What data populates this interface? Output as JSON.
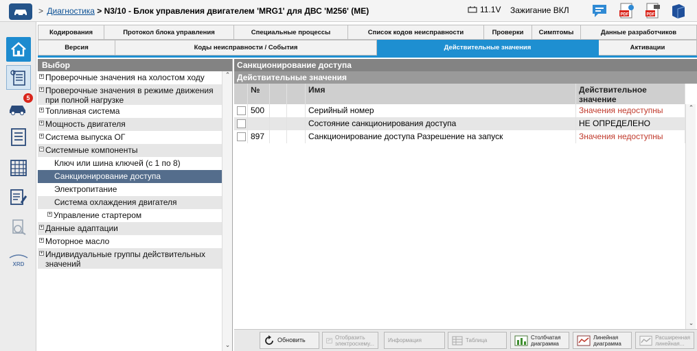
{
  "header": {
    "breadcrumb_sep": ">",
    "breadcrumb_link": "Диагностика",
    "title": "> N3/10 - Блок управления двигателем 'MRG1' для ДВС 'M256' (ME)",
    "voltage": "11.1V",
    "ignition": "Зажигание ВКЛ",
    "icons": [
      "chat-icon",
      "pdf-export-icon",
      "pdf-print-icon",
      "help-book-icon"
    ]
  },
  "rail": {
    "badge_count": "5",
    "xrd_label": "XRD"
  },
  "tabs_row1": [
    "Кодирования",
    "Протокол блока управления",
    "Специальные процессы",
    "Список кодов неисправности",
    "Проверки",
    "Симптомы",
    "Данные разработчиков"
  ],
  "tabs_row2": [
    "Версия",
    "Коды неисправности / События",
    "Действительные значения",
    "Активации"
  ],
  "active_tab": "Действительные значения",
  "left_panel": {
    "title": "Выбор",
    "tree": [
      {
        "label": "Проверочные значения на холостом ходу",
        "expander": "+",
        "level": 0
      },
      {
        "label": "Проверочные значения в режиме движения при полной нагрузке",
        "expander": "+",
        "level": 0
      },
      {
        "label": "Топливная система",
        "expander": "+",
        "level": 0
      },
      {
        "label": "Мощность двигателя",
        "expander": "+",
        "level": 0
      },
      {
        "label": "Система выпуска ОГ",
        "expander": "+",
        "level": 0
      },
      {
        "label": "Системные компоненты",
        "expander": "−",
        "level": 0
      },
      {
        "label": "Ключ или шина ключей (с 1 по 8)",
        "expander": "",
        "level": 1
      },
      {
        "label": "Санкционирование доступа",
        "expander": "",
        "level": 1,
        "selected": true
      },
      {
        "label": "Электропитание",
        "expander": "",
        "level": 1
      },
      {
        "label": "Система охлаждения двигателя",
        "expander": "",
        "level": 1
      },
      {
        "label": "Управление стартером",
        "expander": "+",
        "level": 1
      },
      {
        "label": "Данные адаптации",
        "expander": "+",
        "level": 0
      },
      {
        "label": "Моторное масло",
        "expander": "+",
        "level": 0
      },
      {
        "label": "Индивидуальные группы действительных значений",
        "expander": "+",
        "level": 0
      }
    ]
  },
  "right_panel": {
    "title": "Санкционирование доступа",
    "subtitle": "Действительные значения",
    "columns": {
      "num": "№",
      "name": "Имя",
      "value": "Действительное значение"
    },
    "rows": [
      {
        "num": "500",
        "name": "Серийный номер",
        "value": "Значения недоступны",
        "status": "na"
      },
      {
        "num": "",
        "name": "Состояние санкционирования доступа",
        "value": "НЕ ОПРЕДЕЛЕНО",
        "status": "ok"
      },
      {
        "num": "897",
        "name": "Санкционирование доступа Разрешение на запуск",
        "value": "Значения недоступны",
        "status": "na"
      }
    ]
  },
  "toolbar": {
    "refresh": "Обновить",
    "schematic_1": "Отобразить",
    "schematic_2": "электросхему...",
    "info": "Информация",
    "table": "Таблица",
    "bar_1": "Столбчатая",
    "bar_2": "диаграмма",
    "line_1": "Линейная",
    "line_2": "диаграмма",
    "ext_1": "Расширенная",
    "ext_2": "линейная..."
  },
  "colors": {
    "accent": "#1e8fd1",
    "selected_row": "#546d8c",
    "not_available": "#c0392b"
  }
}
